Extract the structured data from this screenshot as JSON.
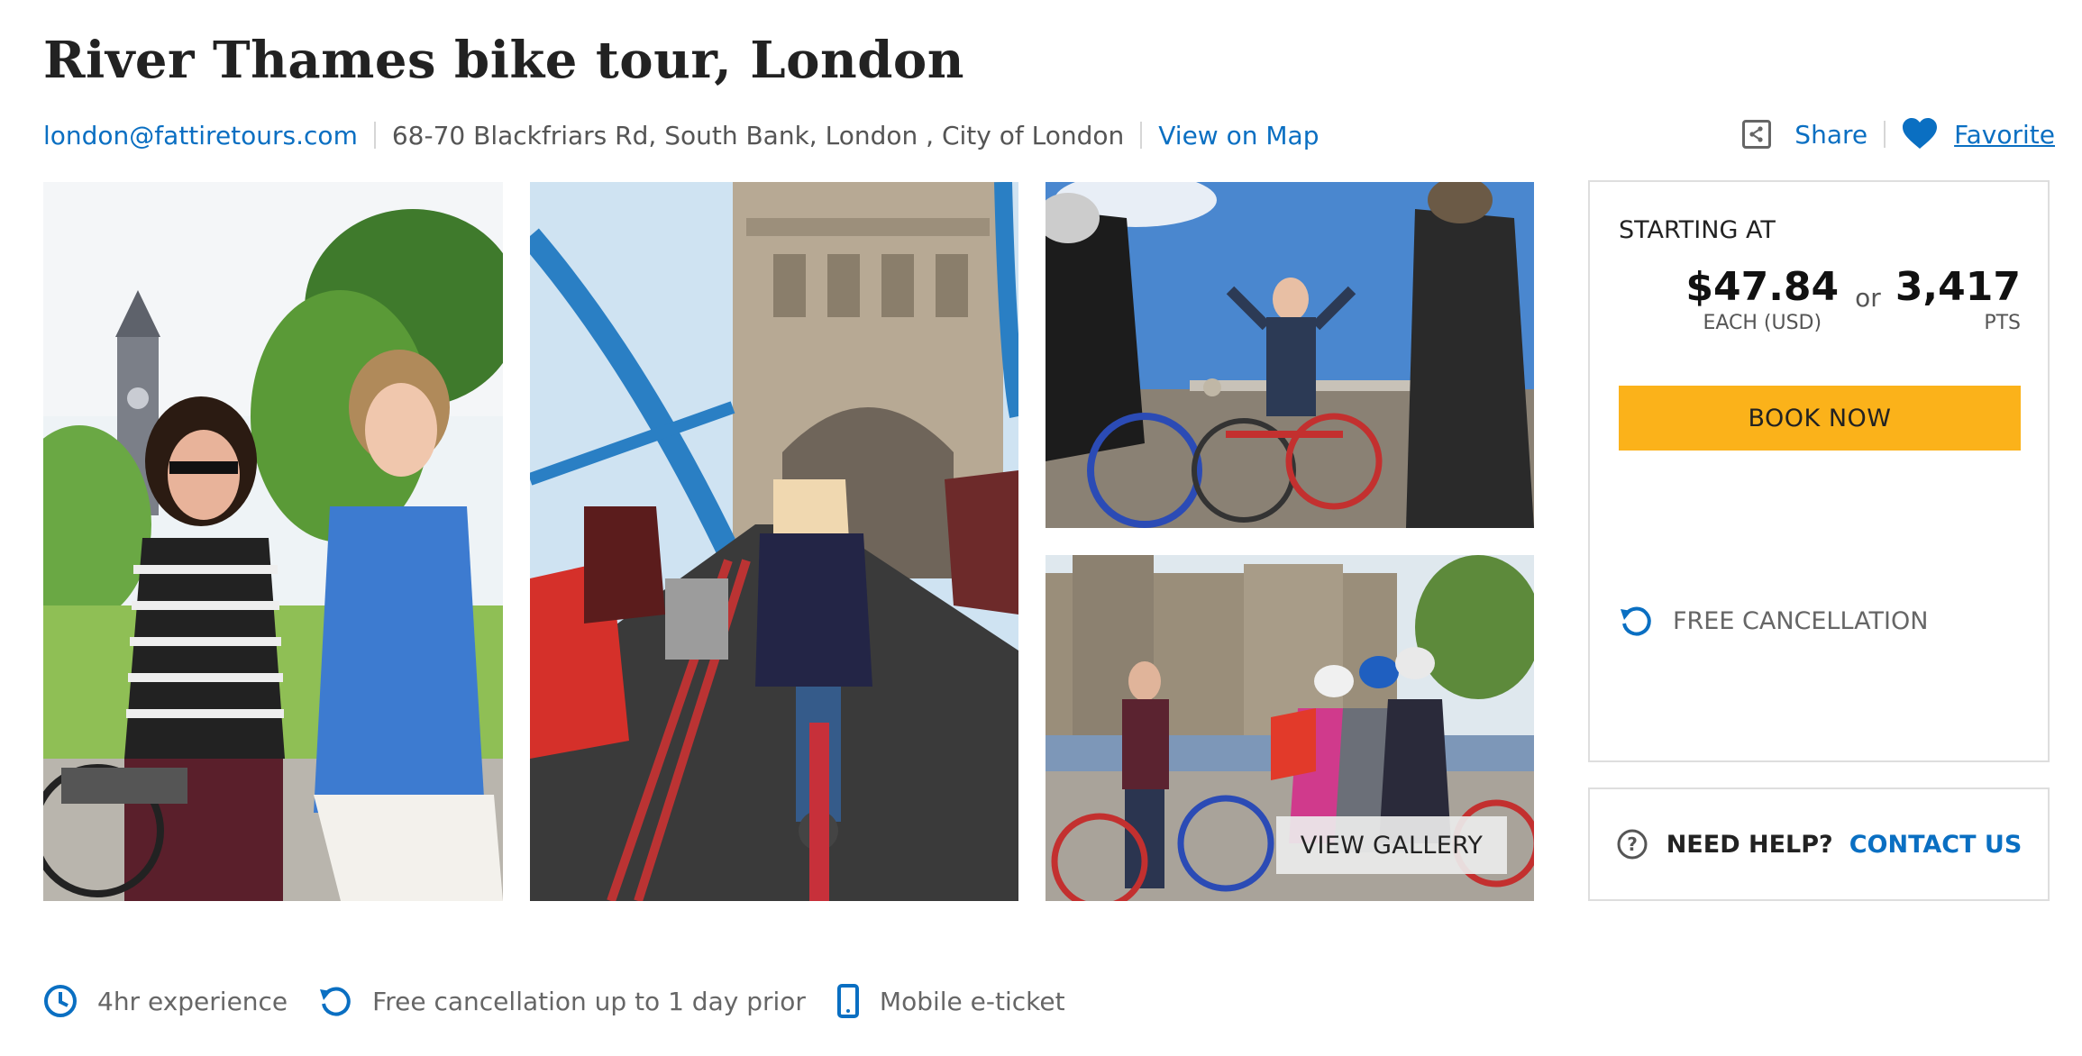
{
  "listing": {
    "title": "River Thames bike tour, London",
    "email": "london@fattiretours.com",
    "address_street": "68-70 Blackfriars Rd, South Bank,",
    "address_city": "London",
    "address_region": ", City of London",
    "view_map": "View on Map"
  },
  "actions": {
    "share": "Share",
    "favorite": "Favorite",
    "share_icon": "share-icon",
    "favorite_icon": "heart-icon"
  },
  "gallery": {
    "view_gallery": "VIEW GALLERY",
    "photos": [
      "women-with-bikes-big-ben",
      "tower-bridge-cyclists",
      "guide-on-riverside",
      "tower-of-london-group"
    ]
  },
  "booking": {
    "starting_at": "STARTING AT",
    "price": "$47.84",
    "price_note": "EACH (USD)",
    "or": "or",
    "points": "3,417",
    "points_note": "PTS",
    "book_now": "BOOK NOW",
    "free_cancellation": "FREE CANCELLATION"
  },
  "help": {
    "need_help": "NEED HELP?",
    "contact": "CONTACT US"
  },
  "features": [
    {
      "icon": "clock-icon",
      "label": "4hr experience"
    },
    {
      "icon": "undo-icon",
      "label": "Free cancellation up to 1 day prior"
    },
    {
      "icon": "mobile-icon",
      "label": "Mobile e-ticket"
    }
  ],
  "colors": {
    "accent": "#0a6fc2",
    "book_button": "#fbb21a",
    "border": "#dedede"
  }
}
